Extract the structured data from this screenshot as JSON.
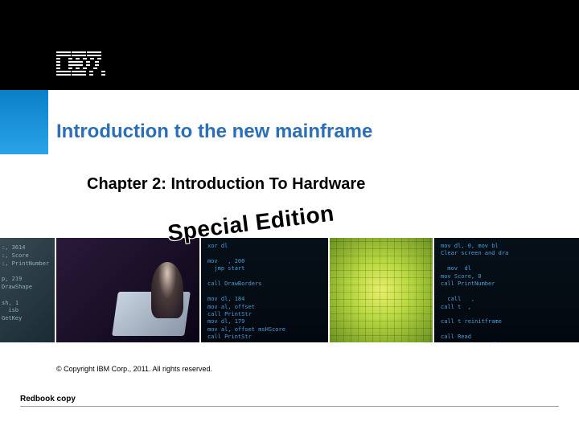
{
  "logo_name": "IBM",
  "title": "Introduction to the new mainframe",
  "chapter": "Chapter 2: Introduction To Hardware",
  "stamp": "Special Edition",
  "copyright": "© Copyright IBM Corp., 2011. All rights reserved.",
  "redbook": "Redbook copy",
  "banner": {
    "p1_code": ":, 3614\n:, Score\n:, PrintNumber\n\np, 219\nDrawShape\n\nsh, 1\n  isb\nGetKey",
    "p3_code": "xor dl\n\nmov   , 200\n  jmp start\n\ncall DrawBorders\n\nmov dl, 184\nmov al, offset\ncall PrintStr\nmov dl, 179\nmov al, offset msHScore\ncall PrintStr",
    "p5_code": "mov dl, 0, mov bl\nClear screen and dra\n\n  mov  dl\nmov Score, 0\ncall PrintNumber\n\n  call   ,\ncall t  ,\n\ncall t reinitframe\n\ncall Read\nmov DrawShape, dh\ncall GetKey"
  }
}
